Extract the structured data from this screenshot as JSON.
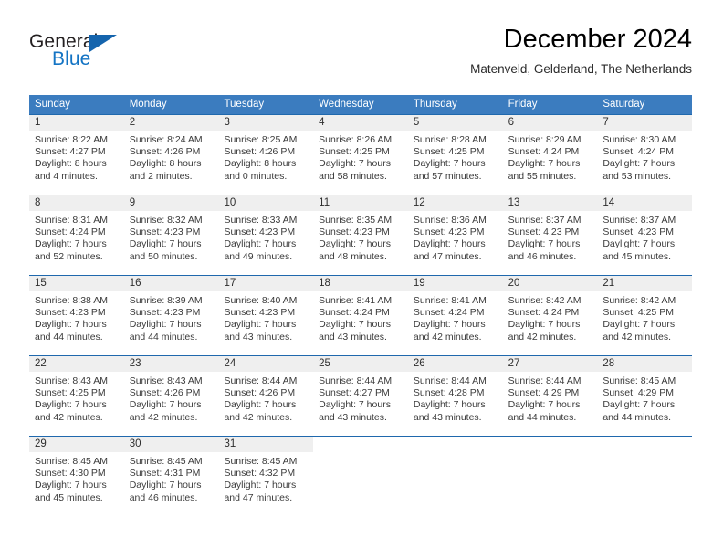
{
  "brand": {
    "name_top": "General",
    "name_bottom": "Blue",
    "color_dark": "#231f20",
    "color_blue": "#1474c4",
    "triangle_color": "#1464ad"
  },
  "header": {
    "title": "December 2024",
    "subtitle": "Matenveld, Gelderland, The Netherlands"
  },
  "colors": {
    "header_row_bg": "#3b7cbf",
    "header_row_text": "#ffffff",
    "week_divider": "#1f68ad",
    "daynum_band_bg": "#efefef",
    "body_text": "#3a3a3a"
  },
  "weekday_headers": [
    "Sunday",
    "Monday",
    "Tuesday",
    "Wednesday",
    "Thursday",
    "Friday",
    "Saturday"
  ],
  "weeks": [
    [
      {
        "day": "1",
        "sunrise": "Sunrise: 8:22 AM",
        "sunset": "Sunset: 4:27 PM",
        "daylight1": "Daylight: 8 hours",
        "daylight2": "and 4 minutes."
      },
      {
        "day": "2",
        "sunrise": "Sunrise: 8:24 AM",
        "sunset": "Sunset: 4:26 PM",
        "daylight1": "Daylight: 8 hours",
        "daylight2": "and 2 minutes."
      },
      {
        "day": "3",
        "sunrise": "Sunrise: 8:25 AM",
        "sunset": "Sunset: 4:26 PM",
        "daylight1": "Daylight: 8 hours",
        "daylight2": "and 0 minutes."
      },
      {
        "day": "4",
        "sunrise": "Sunrise: 8:26 AM",
        "sunset": "Sunset: 4:25 PM",
        "daylight1": "Daylight: 7 hours",
        "daylight2": "and 58 minutes."
      },
      {
        "day": "5",
        "sunrise": "Sunrise: 8:28 AM",
        "sunset": "Sunset: 4:25 PM",
        "daylight1": "Daylight: 7 hours",
        "daylight2": "and 57 minutes."
      },
      {
        "day": "6",
        "sunrise": "Sunrise: 8:29 AM",
        "sunset": "Sunset: 4:24 PM",
        "daylight1": "Daylight: 7 hours",
        "daylight2": "and 55 minutes."
      },
      {
        "day": "7",
        "sunrise": "Sunrise: 8:30 AM",
        "sunset": "Sunset: 4:24 PM",
        "daylight1": "Daylight: 7 hours",
        "daylight2": "and 53 minutes."
      }
    ],
    [
      {
        "day": "8",
        "sunrise": "Sunrise: 8:31 AM",
        "sunset": "Sunset: 4:24 PM",
        "daylight1": "Daylight: 7 hours",
        "daylight2": "and 52 minutes."
      },
      {
        "day": "9",
        "sunrise": "Sunrise: 8:32 AM",
        "sunset": "Sunset: 4:23 PM",
        "daylight1": "Daylight: 7 hours",
        "daylight2": "and 50 minutes."
      },
      {
        "day": "10",
        "sunrise": "Sunrise: 8:33 AM",
        "sunset": "Sunset: 4:23 PM",
        "daylight1": "Daylight: 7 hours",
        "daylight2": "and 49 minutes."
      },
      {
        "day": "11",
        "sunrise": "Sunrise: 8:35 AM",
        "sunset": "Sunset: 4:23 PM",
        "daylight1": "Daylight: 7 hours",
        "daylight2": "and 48 minutes."
      },
      {
        "day": "12",
        "sunrise": "Sunrise: 8:36 AM",
        "sunset": "Sunset: 4:23 PM",
        "daylight1": "Daylight: 7 hours",
        "daylight2": "and 47 minutes."
      },
      {
        "day": "13",
        "sunrise": "Sunrise: 8:37 AM",
        "sunset": "Sunset: 4:23 PM",
        "daylight1": "Daylight: 7 hours",
        "daylight2": "and 46 minutes."
      },
      {
        "day": "14",
        "sunrise": "Sunrise: 8:37 AM",
        "sunset": "Sunset: 4:23 PM",
        "daylight1": "Daylight: 7 hours",
        "daylight2": "and 45 minutes."
      }
    ],
    [
      {
        "day": "15",
        "sunrise": "Sunrise: 8:38 AM",
        "sunset": "Sunset: 4:23 PM",
        "daylight1": "Daylight: 7 hours",
        "daylight2": "and 44 minutes."
      },
      {
        "day": "16",
        "sunrise": "Sunrise: 8:39 AM",
        "sunset": "Sunset: 4:23 PM",
        "daylight1": "Daylight: 7 hours",
        "daylight2": "and 44 minutes."
      },
      {
        "day": "17",
        "sunrise": "Sunrise: 8:40 AM",
        "sunset": "Sunset: 4:23 PM",
        "daylight1": "Daylight: 7 hours",
        "daylight2": "and 43 minutes."
      },
      {
        "day": "18",
        "sunrise": "Sunrise: 8:41 AM",
        "sunset": "Sunset: 4:24 PM",
        "daylight1": "Daylight: 7 hours",
        "daylight2": "and 43 minutes."
      },
      {
        "day": "19",
        "sunrise": "Sunrise: 8:41 AM",
        "sunset": "Sunset: 4:24 PM",
        "daylight1": "Daylight: 7 hours",
        "daylight2": "and 42 minutes."
      },
      {
        "day": "20",
        "sunrise": "Sunrise: 8:42 AM",
        "sunset": "Sunset: 4:24 PM",
        "daylight1": "Daylight: 7 hours",
        "daylight2": "and 42 minutes."
      },
      {
        "day": "21",
        "sunrise": "Sunrise: 8:42 AM",
        "sunset": "Sunset: 4:25 PM",
        "daylight1": "Daylight: 7 hours",
        "daylight2": "and 42 minutes."
      }
    ],
    [
      {
        "day": "22",
        "sunrise": "Sunrise: 8:43 AM",
        "sunset": "Sunset: 4:25 PM",
        "daylight1": "Daylight: 7 hours",
        "daylight2": "and 42 minutes."
      },
      {
        "day": "23",
        "sunrise": "Sunrise: 8:43 AM",
        "sunset": "Sunset: 4:26 PM",
        "daylight1": "Daylight: 7 hours",
        "daylight2": "and 42 minutes."
      },
      {
        "day": "24",
        "sunrise": "Sunrise: 8:44 AM",
        "sunset": "Sunset: 4:26 PM",
        "daylight1": "Daylight: 7 hours",
        "daylight2": "and 42 minutes."
      },
      {
        "day": "25",
        "sunrise": "Sunrise: 8:44 AM",
        "sunset": "Sunset: 4:27 PM",
        "daylight1": "Daylight: 7 hours",
        "daylight2": "and 43 minutes."
      },
      {
        "day": "26",
        "sunrise": "Sunrise: 8:44 AM",
        "sunset": "Sunset: 4:28 PM",
        "daylight1": "Daylight: 7 hours",
        "daylight2": "and 43 minutes."
      },
      {
        "day": "27",
        "sunrise": "Sunrise: 8:44 AM",
        "sunset": "Sunset: 4:29 PM",
        "daylight1": "Daylight: 7 hours",
        "daylight2": "and 44 minutes."
      },
      {
        "day": "28",
        "sunrise": "Sunrise: 8:45 AM",
        "sunset": "Sunset: 4:29 PM",
        "daylight1": "Daylight: 7 hours",
        "daylight2": "and 44 minutes."
      }
    ],
    [
      {
        "day": "29",
        "sunrise": "Sunrise: 8:45 AM",
        "sunset": "Sunset: 4:30 PM",
        "daylight1": "Daylight: 7 hours",
        "daylight2": "and 45 minutes."
      },
      {
        "day": "30",
        "sunrise": "Sunrise: 8:45 AM",
        "sunset": "Sunset: 4:31 PM",
        "daylight1": "Daylight: 7 hours",
        "daylight2": "and 46 minutes."
      },
      {
        "day": "31",
        "sunrise": "Sunrise: 8:45 AM",
        "sunset": "Sunset: 4:32 PM",
        "daylight1": "Daylight: 7 hours",
        "daylight2": "and 47 minutes."
      },
      {
        "day": "",
        "sunrise": "",
        "sunset": "",
        "daylight1": "",
        "daylight2": ""
      },
      {
        "day": "",
        "sunrise": "",
        "sunset": "",
        "daylight1": "",
        "daylight2": ""
      },
      {
        "day": "",
        "sunrise": "",
        "sunset": "",
        "daylight1": "",
        "daylight2": ""
      },
      {
        "day": "",
        "sunrise": "",
        "sunset": "",
        "daylight1": "",
        "daylight2": ""
      }
    ]
  ]
}
